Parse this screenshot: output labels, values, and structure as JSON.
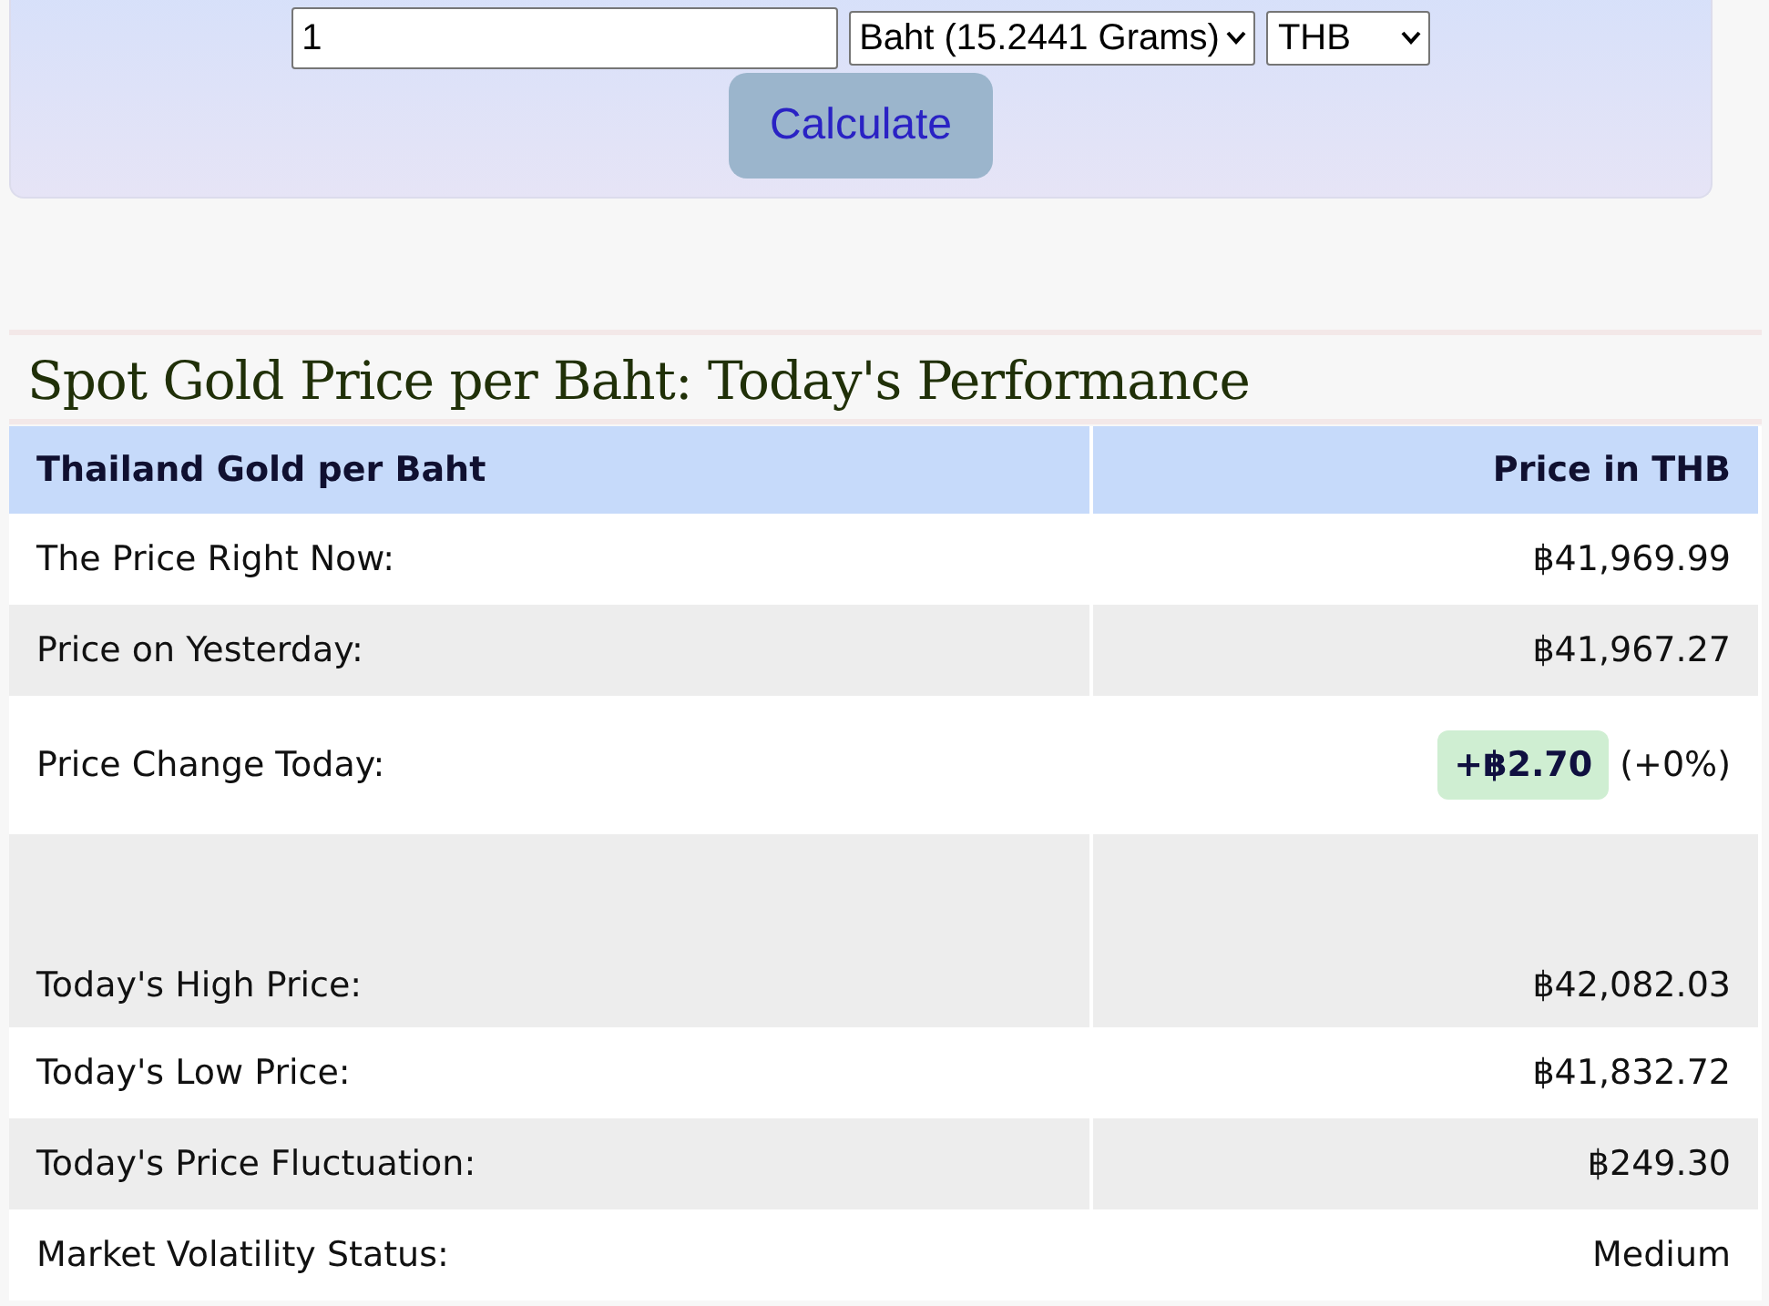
{
  "converter": {
    "amount": "1",
    "unit": "Baht (15.2441 Grams)",
    "currency": "THB",
    "button": "Calculate"
  },
  "section": {
    "title": "Spot Gold Price per Baht: Today's Performance"
  },
  "table": {
    "columns": [
      "Thailand Gold per Baht",
      "Price in THB"
    ],
    "rows": [
      {
        "kind": "plain",
        "label": "The Price Right Now:",
        "value": "฿41,969.99"
      },
      {
        "kind": "plain",
        "label": "Price on Yesterday:",
        "value": "฿41,967.27"
      },
      {
        "kind": "change",
        "label": "Price Change Today:",
        "value": "+฿2.70",
        "percent": "(+0%)"
      },
      {
        "kind": "spaced",
        "label": "Today's High Price:",
        "value": "฿42,082.03"
      },
      {
        "kind": "plain",
        "label": "Today's Low Price:",
        "value": "฿41,832.72"
      },
      {
        "kind": "plain",
        "label": "Today's Price Fluctuation:",
        "value": "฿249.30"
      },
      {
        "kind": "plain",
        "label": "Market Volatility Status:",
        "value": "Medium"
      }
    ]
  }
}
